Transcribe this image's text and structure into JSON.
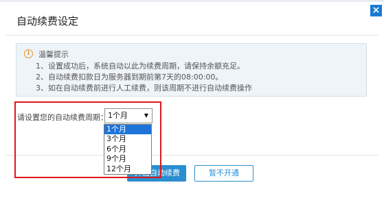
{
  "dialog": {
    "title": "自动续费设定",
    "close_glyph": "×"
  },
  "notice": {
    "title": "温馨提示",
    "lines": [
      "1、设置成功后，系统自动以此为续费周期，请保持余额充足。",
      "2、自动续费扣款日为服务器到期前第7天的08:00:00。",
      "3、如在自动续费前进行人工续费，则该周期不进行自动续费操作"
    ]
  },
  "cycle": {
    "label": "请设置您的自动续费周期：",
    "selected": "1个月",
    "options": [
      "1个月",
      "3个月",
      "6个月",
      "9个月",
      "12个月"
    ]
  },
  "buttons": {
    "enable_label": "开通自动续费",
    "skip_label": "暂不开通"
  },
  "colors": {
    "accent": "#2b8ecf",
    "highlight": "#e0161b",
    "option_selected": "#1e74d8",
    "notice_bg": "#eef4f8",
    "info_icon": "#e4942a"
  }
}
